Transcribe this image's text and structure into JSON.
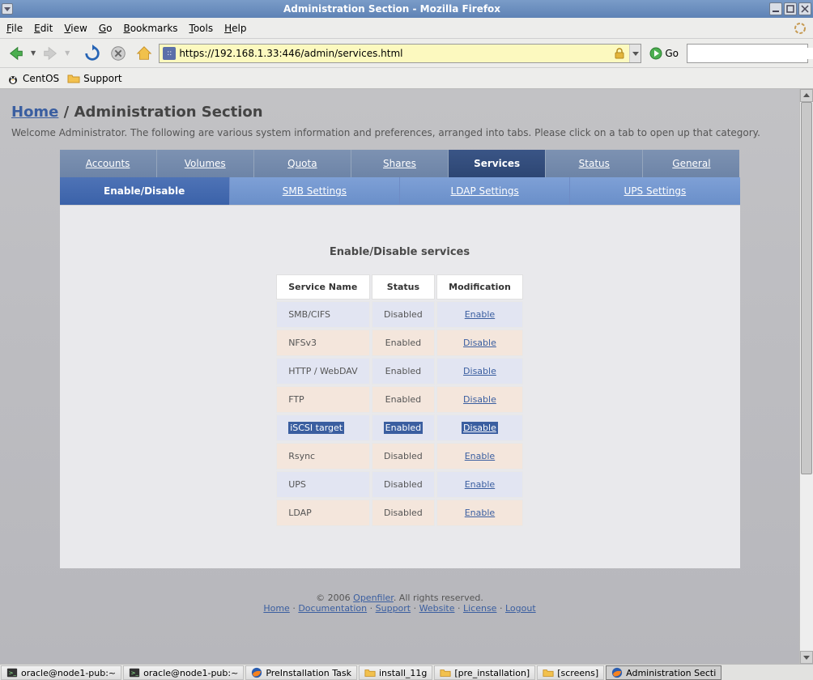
{
  "window": {
    "title": "Administration Section - Mozilla Firefox"
  },
  "menubar": {
    "file": "File",
    "edit": "Edit",
    "view": "View",
    "go": "Go",
    "bookmarks": "Bookmarks",
    "tools": "Tools",
    "help": "Help"
  },
  "toolbar": {
    "url": "https://192.168.1.33:446/admin/services.html",
    "go_label": "Go"
  },
  "bookmarks": {
    "centos": "CentOS",
    "support": "Support"
  },
  "breadcrumb": {
    "home": "Home",
    "sep": " / ",
    "current": "Administration Section"
  },
  "welcome": "Welcome Administrator. The following are various system information and preferences, arranged into tabs. Please click on a tab to open up that category.",
  "tabs": {
    "main": [
      "Accounts",
      "Volumes",
      "Quota",
      "Shares",
      "Services",
      "Status",
      "General"
    ],
    "active_main": 4,
    "sub": [
      "Enable/Disable",
      "SMB Settings",
      "LDAP Settings",
      "UPS Settings"
    ],
    "active_sub": 0
  },
  "panel": {
    "heading": "Enable/Disable services",
    "headers": {
      "name": "Service Name",
      "status": "Status",
      "mod": "Modification"
    },
    "rows": [
      {
        "name": "SMB/CIFS",
        "status": "Disabled",
        "action": "Enable",
        "hl": false
      },
      {
        "name": "NFSv3",
        "status": "Enabled",
        "action": "Disable",
        "hl": false
      },
      {
        "name": "HTTP / WebDAV",
        "status": "Enabled",
        "action": "Disable",
        "hl": false
      },
      {
        "name": "FTP",
        "status": "Enabled",
        "action": "Disable",
        "hl": false
      },
      {
        "name": "iSCSI target",
        "status": "Enabled",
        "action": "Disable",
        "hl": true
      },
      {
        "name": "Rsync",
        "status": "Disabled",
        "action": "Enable",
        "hl": false
      },
      {
        "name": "UPS",
        "status": "Disabled",
        "action": "Enable",
        "hl": false
      },
      {
        "name": "LDAP",
        "status": "Disabled",
        "action": "Enable",
        "hl": false
      }
    ]
  },
  "footer": {
    "copyright_prefix": "© 2006 ",
    "brand": "Openfiler",
    "copyright_suffix": ". All rights reserved.",
    "links": [
      "Home",
      "Documentation",
      "Support",
      "Website",
      "License",
      "Logout"
    ],
    "dot": " · "
  },
  "taskbar": [
    {
      "label": "oracle@node1-pub:~",
      "icon": "terminal"
    },
    {
      "label": "oracle@node1-pub:~",
      "icon": "terminal"
    },
    {
      "label": "PreInstallation Task",
      "icon": "firefox"
    },
    {
      "label": "install_11g",
      "icon": "folder"
    },
    {
      "label": "[pre_installation]",
      "icon": "folder"
    },
    {
      "label": "[screens]",
      "icon": "folder"
    },
    {
      "label": "Administration Secti",
      "icon": "firefox",
      "active": true
    }
  ]
}
